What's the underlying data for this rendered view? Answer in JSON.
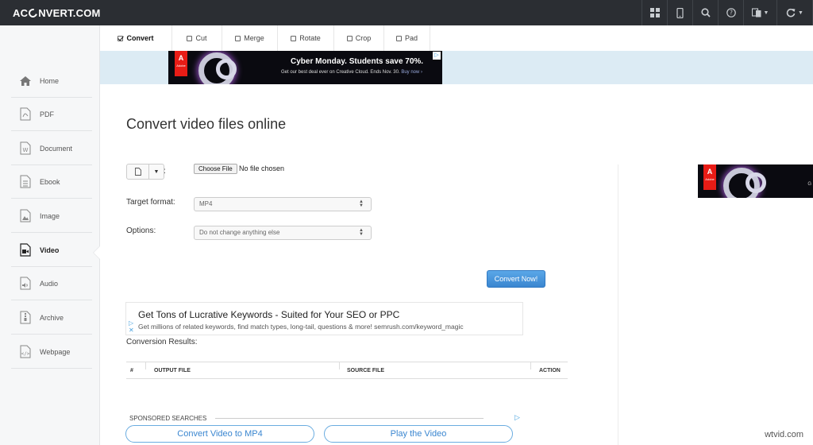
{
  "header": {
    "logo_pre": "AC",
    "logo_post": "NVERT.COM",
    "icons": [
      "grid-icon",
      "mobile-icon",
      "search-icon",
      "help-icon",
      "language-icon",
      "refresh-icon"
    ]
  },
  "tabs": [
    {
      "label": "Convert",
      "checked": true
    },
    {
      "label": "Cut",
      "checked": false
    },
    {
      "label": "Merge",
      "checked": false
    },
    {
      "label": "Rotate",
      "checked": false
    },
    {
      "label": "Crop",
      "checked": false
    },
    {
      "label": "Pad",
      "checked": false
    }
  ],
  "sidebar": {
    "items": [
      {
        "label": "Home",
        "icon": "home-icon"
      },
      {
        "label": "PDF",
        "icon": "pdf-icon"
      },
      {
        "label": "Document",
        "icon": "document-icon"
      },
      {
        "label": "Ebook",
        "icon": "ebook-icon"
      },
      {
        "label": "Image",
        "icon": "image-icon"
      },
      {
        "label": "Video",
        "icon": "video-icon",
        "active": true
      },
      {
        "label": "Audio",
        "icon": "audio-icon"
      },
      {
        "label": "Archive",
        "icon": "archive-icon"
      },
      {
        "label": "Webpage",
        "icon": "webpage-icon"
      }
    ]
  },
  "banner_ad": {
    "brand": "Adobe",
    "headline": "Cyber Monday. Students save 70%.",
    "sub": "Get our best deal ever on Creative Cloud. Ends Nov. 30.",
    "cta": "Buy now ›"
  },
  "right_ad": {
    "brand": "Adobe",
    "tiny": "G"
  },
  "main": {
    "title": "Convert video files online",
    "source_colon": ":",
    "choose_file": "Choose File",
    "no_file": "No file chosen",
    "target_label": "Target format:",
    "target_value": "MP4",
    "options_label": "Options:",
    "options_value": "Do not change anything else",
    "convert_button": "Convert Now!"
  },
  "text_ad": {
    "headline": "Get Tons of Lucrative Keywords - Suited for Your SEO or PPC",
    "sub": "Get millions of related keywords, find match types, long-tail, questions & more! semrush.com/keyword_magic"
  },
  "results": {
    "title": "Conversion Results:",
    "columns": [
      "#",
      "OUTPUT FILE",
      "SOURCE FILE",
      "ACTION"
    ]
  },
  "sponsored": {
    "label": "SPONSORED SEARCHES",
    "links": [
      "Convert Video to MP4",
      "Play the Video"
    ]
  },
  "watermark": "wtvid.com",
  "colors": {
    "topbar": "#2b2e33",
    "accent": "#3a86d0",
    "banner_bg": "#dcebf4"
  }
}
